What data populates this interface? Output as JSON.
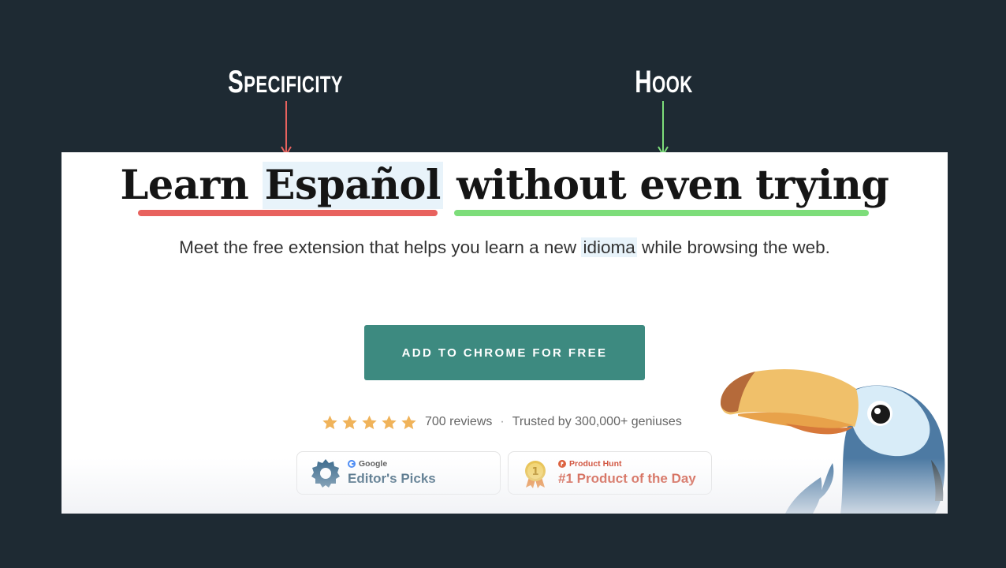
{
  "annotations": {
    "left": {
      "first": "S",
      "rest": "PECIFICITY",
      "color": "#e8625e"
    },
    "right": {
      "first": "H",
      "rest": "OOK",
      "color": "#7ddd7a"
    }
  },
  "hero": {
    "headline": {
      "part1": "Learn",
      "part2": "Español",
      "part3": "without even trying"
    },
    "subtitle": {
      "before": "Meet the free extension that helps you learn a new",
      "highlight": "idioma",
      "after": "while browsing the web."
    },
    "cta_label": "ADD TO CHROME FOR FREE",
    "rating": {
      "stars": 5,
      "reviews": "700 reviews",
      "separator": "·",
      "trust": "Trusted by 300,000+ geniuses"
    },
    "badges": {
      "google": {
        "source": "Google",
        "title": "Editor's Picks"
      },
      "producthunt": {
        "source": "Product Hunt",
        "title": "#1 Product of the Day",
        "medal": "1"
      }
    }
  },
  "colors": {
    "background": "#1e2a33",
    "accent_button": "#3d8a80",
    "specificity_underline": "#e8625e",
    "hook_underline": "#7ddd7a",
    "highlight_bg": "#e8f3fa",
    "star": "#f0b35a"
  },
  "icons": [
    "arrow-down-icon",
    "star-icon",
    "google-badge-icon",
    "google-g-icon",
    "producthunt-icon",
    "medal-icon",
    "toucan-mascot"
  ]
}
